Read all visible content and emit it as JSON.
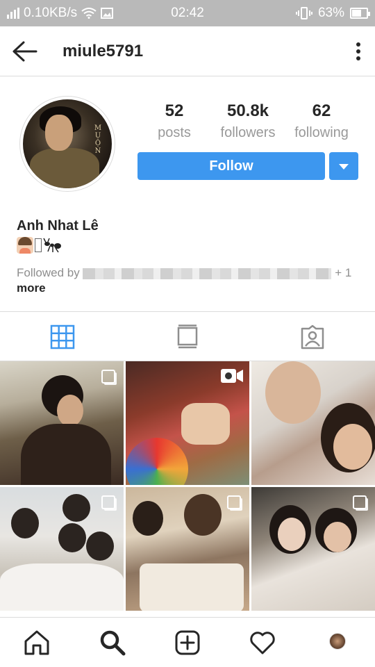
{
  "status_bar": {
    "network": "0.10KB/s",
    "time": "02:42",
    "battery": "63%",
    "battery_level": 0.63
  },
  "header": {
    "username": "miule5791",
    "back_icon": "back-arrow-icon",
    "more_icon": "more-vertical-icon"
  },
  "profile": {
    "stats": [
      {
        "value": "52",
        "label": "posts"
      },
      {
        "value": "50.8k",
        "label": "followers"
      },
      {
        "value": "62",
        "label": "following"
      }
    ],
    "follow_label": "Follow",
    "name": "Anh Nhat Lê",
    "bio_emojis": [
      "woman-emoji",
      "unknown-glyph",
      "ant-emoji"
    ],
    "followed_by_prefix": "Followed by",
    "followed_by_suffix": "+ 1",
    "followed_by_more": "more",
    "accent_color": "#3d97ef"
  },
  "tabs": [
    {
      "icon": "grid-icon",
      "active": true
    },
    {
      "icon": "feed-icon",
      "active": false
    },
    {
      "icon": "tagged-icon",
      "active": false
    }
  ],
  "posts": [
    {
      "badge": "multiple-photos-icon"
    },
    {
      "badge": "video-icon"
    },
    {
      "badge": ""
    },
    {
      "badge": "multiple-photos-icon"
    },
    {
      "badge": "multiple-photos-icon"
    },
    {
      "badge": "multiple-photos-icon"
    }
  ],
  "bottom_nav": [
    "home-icon",
    "search-icon",
    "add-icon",
    "heart-icon",
    "profile-avatar"
  ]
}
